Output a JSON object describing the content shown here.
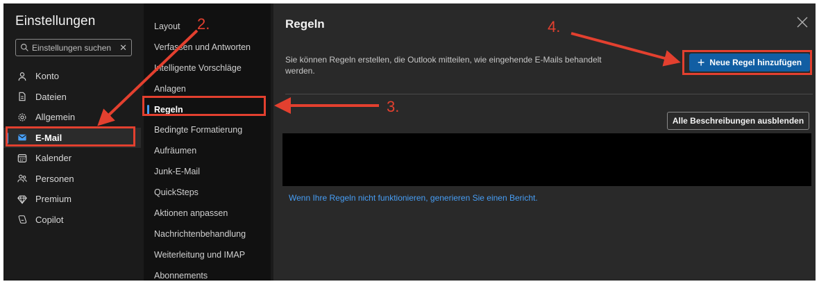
{
  "settings": {
    "title": "Einstellungen",
    "search_placeholder": "Einstellungen suchen",
    "search_icon": "search-icon",
    "clear_glyph": "✕"
  },
  "nav": {
    "items": [
      {
        "label": "Konto",
        "icon": "person-icon"
      },
      {
        "label": "Dateien",
        "icon": "document-icon"
      },
      {
        "label": "Allgemein",
        "icon": "gear-icon"
      },
      {
        "label": "E-Mail",
        "icon": "mail-icon",
        "active": true
      },
      {
        "label": "Kalender",
        "icon": "calendar-icon"
      },
      {
        "label": "Personen",
        "icon": "people-icon"
      },
      {
        "label": "Premium",
        "icon": "diamond-icon"
      },
      {
        "label": "Copilot",
        "icon": "copilot-icon"
      }
    ]
  },
  "mail_menu": {
    "items": [
      {
        "label": "Layout"
      },
      {
        "label": "Verfassen und Antworten"
      },
      {
        "label": "Intelligente Vorschläge"
      },
      {
        "label": "Anlagen"
      },
      {
        "label": "Regeln",
        "active": true
      },
      {
        "label": "Bedingte Formatierung"
      },
      {
        "label": "Aufräumen"
      },
      {
        "label": "Junk-E-Mail"
      },
      {
        "label": "QuickSteps"
      },
      {
        "label": "Aktionen anpassen"
      },
      {
        "label": "Nachrichtenbehandlung"
      },
      {
        "label": "Weiterleitung und IMAP"
      },
      {
        "label": "Abonnements"
      }
    ]
  },
  "rules_panel": {
    "title": "Regeln",
    "description": "Sie können Regeln erstellen, die Outlook mitteilen, wie eingehende E-Mails behandelt werden.",
    "add_rule_label": "Neue Regel hinzufügen",
    "add_rule_icon": "plus-icon",
    "hide_descriptions_label": "Alle Beschreibungen ausblenden",
    "report_link": "Wenn Ihre Regeln nicht funktionieren, generieren Sie einen Bericht.",
    "close_icon": "close-icon"
  },
  "annotations": {
    "step2": "2.",
    "step3": "3.",
    "step4": "4."
  },
  "colors": {
    "accent": "#479ef5",
    "primary_button": "#115ea3",
    "annotation_red": "#e3402f",
    "panel_bg": "#292929",
    "sidebar_bg": "#1b1b1b",
    "menu_bg": "#111111"
  }
}
